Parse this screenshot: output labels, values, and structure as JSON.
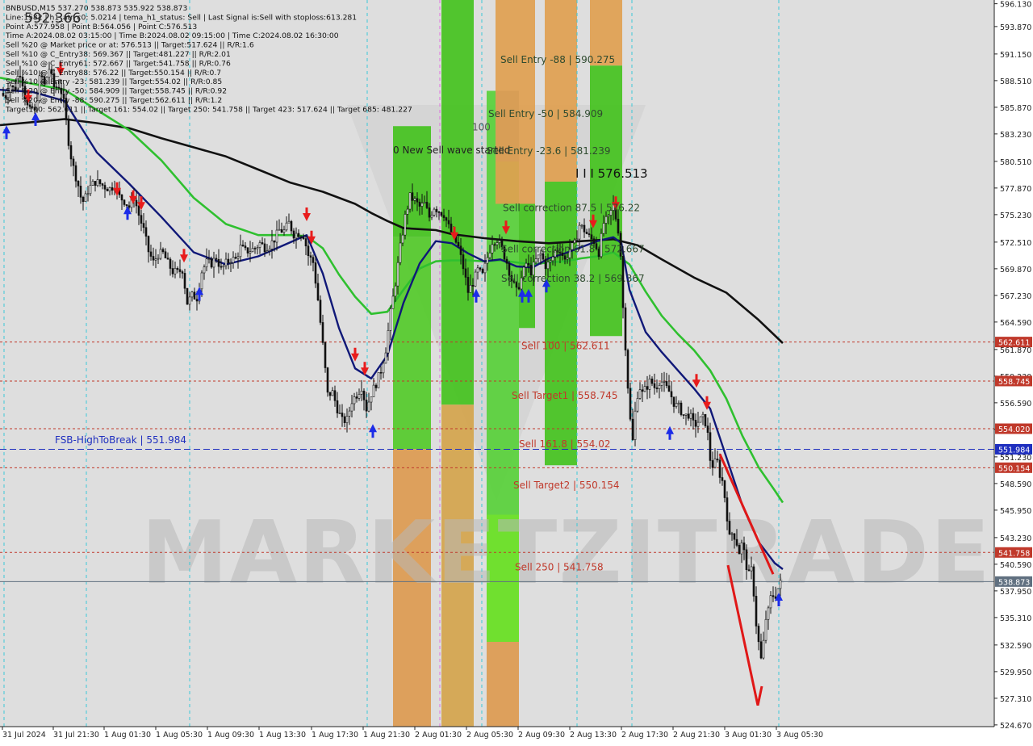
{
  "info_lines": [
    "BNBUSD,M15  537.270 538.873 535.922 538.873",
    "Line:1582 | h1_atr_c0: 5.0214 | tema_h1_status: Sell | Last Signal is:Sell with stoploss:613.281",
    "Point A:577.958 | Point B:564.056 | Point C:576.513",
    "Time A:2024.08.02 03:15:00 | Time B:2024.08.02 09:15:00 | Time C:2024.08.02 16:30:00",
    "Sell %20 @ Market price or at: 576.513 || Target:517.624 || R/R:1.6",
    "Sell %10 @ C_Entry38: 569.367 || Target:481.227 || R/R:2.01",
    "Sell %10 @ C_Entry61: 572.667 || Target:541.758 || R/R:0.76",
    "Sell %10 @ C_Entry88: 576.22 || Target:550.154 || R/R:0.7",
    "Sell %10 @ Entry -23: 581.239 || Target:554.02 || R/R:0.85",
    "Sell %20 @ Entry -50: 584.909 || Target:558.745 || R/R:0.92",
    "Sell %20 @ Entry -88: 590.275 || Target:562.611 || R/R:1.2",
    "Target100: 562.611 || Target 161: 554.02 || Target 250: 541.758 || Target 423: 517.624 || Target 685: 481.227"
  ],
  "top_value_label": "592.366",
  "watermark": "MARKETZITRADE",
  "chart_data": {
    "type": "candlestick",
    "symbol": "BNBUSD",
    "timeframe": "M15",
    "ylim": [
      524.5,
      596.5
    ],
    "y_ticks": [
      "596.130",
      "593.870",
      "591.150",
      "588.510",
      "585.870",
      "583.230",
      "580.510",
      "577.870",
      "575.230",
      "572.510",
      "569.870",
      "567.230",
      "564.590",
      "561.870",
      "559.230",
      "556.590",
      "553.950",
      "551.230",
      "548.590",
      "545.950",
      "543.230",
      "540.590",
      "537.950",
      "535.310",
      "532.590",
      "529.950",
      "527.310",
      "524.670"
    ],
    "x_ticks": [
      "31 Jul 2024",
      "31 Jul 21:30",
      "1 Aug 01:30",
      "1 Aug 05:30",
      "1 Aug 09:30",
      "1 Aug 13:30",
      "1 Aug 17:30",
      "1 Aug 21:30",
      "2 Aug 01:30",
      "2 Aug 05:30",
      "2 Aug 09:30",
      "2 Aug 13:30",
      "2 Aug 17:30",
      "2 Aug 21:30",
      "3 Aug 01:30",
      "3 Aug 05:30"
    ],
    "close_path": [
      [
        0,
        587.5
      ],
      [
        6,
        586.8
      ],
      [
        12,
        588.2
      ],
      [
        18,
        587.5
      ],
      [
        24,
        589.6
      ],
      [
        28,
        588.3
      ],
      [
        32,
        586.5
      ],
      [
        36,
        585.4
      ],
      [
        40,
        585.8
      ],
      [
        44,
        585.2
      ],
      [
        48,
        588.6
      ],
      [
        52,
        588.8
      ],
      [
        56,
        587.8
      ],
      [
        60,
        590.0
      ],
      [
        64,
        588.8
      ],
      [
        68,
        587.6
      ],
      [
        72,
        588.2
      ],
      [
        76,
        587.4
      ],
      [
        80,
        586.0
      ],
      [
        84,
        583.0
      ],
      [
        88,
        581.0
      ],
      [
        92,
        579.5
      ],
      [
        96,
        578.5
      ],
      [
        100,
        577.0
      ],
      [
        104,
        576.4
      ],
      [
        108,
        577.5
      ],
      [
        112,
        578.0
      ],
      [
        118,
        578.5
      ],
      [
        124,
        578.3
      ],
      [
        130,
        578.0
      ],
      [
        136,
        577.8
      ],
      [
        142,
        578.2
      ],
      [
        148,
        577.0
      ],
      [
        154,
        576.6
      ],
      [
        160,
        576.0
      ],
      [
        166,
        577.0
      ],
      [
        172,
        575.2
      ],
      [
        178,
        573.7
      ],
      [
        184,
        571.6
      ],
      [
        190,
        570.5
      ],
      [
        196,
        571.3
      ],
      [
        202,
        571.4
      ],
      [
        208,
        570.4
      ],
      [
        214,
        569.6
      ],
      [
        220,
        569.5
      ],
      [
        226,
        569.8
      ],
      [
        232,
        566.5
      ],
      [
        238,
        567.2
      ],
      [
        244,
        567.0
      ],
      [
        250,
        569.6
      ],
      [
        256,
        570.5
      ],
      [
        262,
        570.4
      ],
      [
        268,
        571.0
      ],
      [
        274,
        569.8
      ],
      [
        280,
        570.4
      ],
      [
        286,
        570.8
      ],
      [
        292,
        570.8
      ],
      [
        298,
        572.0
      ],
      [
        304,
        571.6
      ],
      [
        310,
        571.7
      ],
      [
        316,
        571.9
      ],
      [
        322,
        572.4
      ],
      [
        328,
        572.0
      ],
      [
        334,
        572.2
      ],
      [
        340,
        572.8
      ],
      [
        346,
        573.7
      ],
      [
        352,
        573.6
      ],
      [
        358,
        574.4
      ],
      [
        364,
        573.3
      ],
      [
        370,
        573.4
      ],
      [
        376,
        573.2
      ],
      [
        382,
        571.2
      ],
      [
        388,
        570.5
      ],
      [
        394,
        566.8
      ],
      [
        400,
        562.3
      ],
      [
        406,
        557.4
      ],
      [
        412,
        557.6
      ],
      [
        418,
        556.0
      ],
      [
        424,
        554.8
      ],
      [
        430,
        554.9
      ],
      [
        436,
        556.8
      ],
      [
        442,
        557.4
      ],
      [
        448,
        558.2
      ],
      [
        454,
        556.0
      ],
      [
        460,
        557.5
      ],
      [
        466,
        558.5
      ],
      [
        472,
        559.8
      ],
      [
        478,
        561.9
      ],
      [
        484,
        565.5
      ],
      [
        490,
        568.5
      ],
      [
        496,
        572.0
      ],
      [
        502,
        575.0
      ],
      [
        508,
        577.0
      ],
      [
        514,
        576.6
      ],
      [
        520,
        576.0
      ],
      [
        526,
        576.3
      ],
      [
        532,
        575.0
      ],
      [
        538,
        576.0
      ],
      [
        544,
        575.6
      ],
      [
        550,
        575.3
      ],
      [
        556,
        574.0
      ],
      [
        562,
        573.0
      ],
      [
        568,
        572.0
      ],
      [
        574,
        570.0
      ],
      [
        580,
        567.6
      ],
      [
        586,
        568.5
      ],
      [
        592,
        569.7
      ],
      [
        598,
        569.2
      ],
      [
        604,
        571.0
      ],
      [
        610,
        572.6
      ],
      [
        616,
        572.8
      ],
      [
        622,
        571.8
      ],
      [
        628,
        570.5
      ],
      [
        634,
        568.8
      ],
      [
        640,
        567.6
      ],
      [
        646,
        568.9
      ],
      [
        652,
        570.4
      ],
      [
        658,
        569.6
      ],
      [
        664,
        570.7
      ],
      [
        670,
        571.3
      ],
      [
        676,
        570.2
      ],
      [
        682,
        570.5
      ],
      [
        688,
        571.6
      ],
      [
        694,
        571.8
      ],
      [
        700,
        570.7
      ],
      [
        706,
        571.8
      ],
      [
        712,
        572.3
      ],
      [
        718,
        574.2
      ],
      [
        724,
        573.7
      ],
      [
        730,
        573.0
      ],
      [
        736,
        572.6
      ],
      [
        742,
        571.5
      ],
      [
        748,
        574.4
      ],
      [
        754,
        574.8
      ],
      [
        760,
        576.2
      ],
      [
        764,
        574.5
      ],
      [
        768,
        573.0
      ],
      [
        772,
        566.0
      ],
      [
        776,
        561.0
      ],
      [
        780,
        555.5
      ],
      [
        784,
        552.8
      ],
      [
        788,
        556.6
      ],
      [
        792,
        558.3
      ],
      [
        796,
        557.5
      ],
      [
        800,
        558.0
      ],
      [
        806,
        558.8
      ],
      [
        812,
        558.0
      ],
      [
        818,
        558.9
      ],
      [
        824,
        558.2
      ],
      [
        830,
        557.6
      ],
      [
        836,
        556.4
      ],
      [
        842,
        556.1
      ],
      [
        848,
        555.2
      ],
      [
        854,
        555.5
      ],
      [
        860,
        554.3
      ],
      [
        866,
        554.8
      ],
      [
        872,
        555.1
      ],
      [
        876,
        554.2
      ],
      [
        880,
        551.0
      ],
      [
        884,
        550.2
      ],
      [
        888,
        551.1
      ],
      [
        892,
        549.5
      ],
      [
        896,
        548.6
      ],
      [
        900,
        546.0
      ],
      [
        904,
        543.2
      ],
      [
        908,
        543.8
      ],
      [
        912,
        543.0
      ],
      [
        916,
        541.8
      ],
      [
        920,
        542.8
      ],
      [
        924,
        540.7
      ],
      [
        928,
        539.5
      ],
      [
        932,
        540.2
      ],
      [
        936,
        535.3
      ],
      [
        940,
        532.8
      ],
      [
        944,
        530.6
      ],
      [
        948,
        535.0
      ],
      [
        952,
        535.9
      ],
      [
        956,
        537.7
      ],
      [
        960,
        537.3
      ],
      [
        964,
        538.2
      ],
      [
        968,
        538.873
      ]
    ],
    "ema_blue": [
      [
        0,
        587.6
      ],
      [
        40,
        587.4
      ],
      [
        80,
        586.5
      ],
      [
        120,
        581.4
      ],
      [
        160,
        578.3
      ],
      [
        200,
        575.0
      ],
      [
        240,
        571.5
      ],
      [
        280,
        570.3
      ],
      [
        320,
        571.1
      ],
      [
        360,
        572.5
      ],
      [
        380,
        573.2
      ],
      [
        400,
        569.4
      ],
      [
        420,
        564.0
      ],
      [
        440,
        560.0
      ],
      [
        460,
        559.0
      ],
      [
        480,
        561.3
      ],
      [
        500,
        566.5
      ],
      [
        520,
        570.4
      ],
      [
        540,
        572.6
      ],
      [
        560,
        572.4
      ],
      [
        580,
        571.4
      ],
      [
        600,
        570.6
      ],
      [
        620,
        570.8
      ],
      [
        640,
        570.1
      ],
      [
        660,
        570.0
      ],
      [
        680,
        570.9
      ],
      [
        700,
        571.4
      ],
      [
        720,
        572.0
      ],
      [
        740,
        572.6
      ],
      [
        760,
        573.0
      ],
      [
        770,
        572.4
      ],
      [
        780,
        567.8
      ],
      [
        800,
        563.6
      ],
      [
        820,
        561.6
      ],
      [
        840,
        559.8
      ],
      [
        860,
        558.0
      ],
      [
        880,
        556.0
      ],
      [
        900,
        551.2
      ],
      [
        920,
        546.4
      ],
      [
        940,
        542.8
      ],
      [
        960,
        540.7
      ],
      [
        970,
        540.1
      ]
    ],
    "ema_green": [
      [
        0,
        588.8
      ],
      [
        40,
        588.2
      ],
      [
        80,
        587.6
      ],
      [
        120,
        585.6
      ],
      [
        160,
        583.6
      ],
      [
        200,
        580.6
      ],
      [
        240,
        576.9
      ],
      [
        280,
        574.3
      ],
      [
        320,
        573.2
      ],
      [
        360,
        573.2
      ],
      [
        380,
        573.1
      ],
      [
        400,
        571.9
      ],
      [
        420,
        569.3
      ],
      [
        440,
        567.1
      ],
      [
        460,
        565.4
      ],
      [
        480,
        565.6
      ],
      [
        500,
        567.8
      ],
      [
        520,
        569.9
      ],
      [
        540,
        570.6
      ],
      [
        560,
        570.7
      ],
      [
        580,
        570.7
      ],
      [
        600,
        570.6
      ],
      [
        620,
        570.7
      ],
      [
        640,
        570.5
      ],
      [
        660,
        570.3
      ],
      [
        680,
        570.5
      ],
      [
        700,
        570.6
      ],
      [
        720,
        570.9
      ],
      [
        740,
        571.1
      ],
      [
        760,
        571.5
      ],
      [
        780,
        570.3
      ],
      [
        800,
        567.6
      ],
      [
        820,
        565.2
      ],
      [
        840,
        563.4
      ],
      [
        860,
        561.8
      ],
      [
        880,
        559.8
      ],
      [
        900,
        557.0
      ],
      [
        920,
        553.3
      ],
      [
        940,
        550.2
      ],
      [
        960,
        547.9
      ],
      [
        970,
        546.7
      ]
    ],
    "ema_black": [
      [
        0,
        584.1
      ],
      [
        40,
        584.4
      ],
      [
        80,
        584.7
      ],
      [
        120,
        584.3
      ],
      [
        160,
        583.8
      ],
      [
        200,
        582.8
      ],
      [
        240,
        581.9
      ],
      [
        280,
        581.0
      ],
      [
        320,
        579.7
      ],
      [
        360,
        578.4
      ],
      [
        400,
        577.5
      ],
      [
        440,
        576.3
      ],
      [
        460,
        575.4
      ],
      [
        480,
        574.6
      ],
      [
        500,
        573.9
      ],
      [
        520,
        573.8
      ],
      [
        540,
        573.7
      ],
      [
        560,
        573.3
      ],
      [
        600,
        572.9
      ],
      [
        640,
        572.6
      ],
      [
        680,
        572.4
      ],
      [
        720,
        572.6
      ],
      [
        760,
        572.8
      ],
      [
        790,
        572.2
      ],
      [
        820,
        570.8
      ],
      [
        860,
        569.0
      ],
      [
        900,
        567.5
      ],
      [
        940,
        564.8
      ],
      [
        970,
        562.5
      ]
    ],
    "h_lines": [
      {
        "name": "Sell 100 | 562.611",
        "value": 562.611,
        "color": "#c0392b",
        "axis_label": "562.611"
      },
      {
        "name": "Sell Target1 | 558.745",
        "value": 558.745,
        "color": "#c0392b",
        "axis_label": "558.745"
      },
      {
        "name": "Sell 161.8 | 554.02",
        "value": 554.02,
        "color": "#c0392b",
        "axis_label": "554.020"
      },
      {
        "name": "FSB-HighToBreak | 551.984",
        "value": 551.984,
        "color": "#1f2fbf",
        "axis_label": "551.984"
      },
      {
        "name": "Sell Target2 | 550.154",
        "value": 550.154,
        "color": "#c0392b",
        "axis_label": "550.154"
      },
      {
        "name": "Sell 250 | 541.758",
        "value": 541.758,
        "color": "#c0392b",
        "axis_label": "541.758"
      },
      {
        "name": "",
        "value": 538.873,
        "color": "#607080",
        "axis_label": "538.873"
      }
    ],
    "annotations": [
      {
        "text": "Sell Entry -88 | 590.275",
        "x": 620,
        "value": 590.275,
        "color": "#2e4a2e"
      },
      {
        "text": "Sell Entry -50 | 584.909",
        "x": 605,
        "value": 584.909,
        "color": "#2e4a2e"
      },
      {
        "text": "100",
        "x": 585,
        "value": 583.6,
        "color": "#555555"
      },
      {
        "text": "0 New Sell wave started",
        "x": 487,
        "value": 581.3,
        "color": "#222222"
      },
      {
        "text": "Sell Entry -23.6 | 581.239",
        "x": 603,
        "value": 581.239,
        "color": "#2e4a2e"
      },
      {
        "text": "I I I 576.513",
        "x": 713,
        "value": 578.9,
        "color": "#111111",
        "large": true
      },
      {
        "text": "Sell correction 87.5 | 576.22",
        "x": 623,
        "value": 575.6,
        "color": "#2e4a2e"
      },
      {
        "text": "Sell correction 61.8 | 572.667",
        "x": 621,
        "value": 571.5,
        "color": "#2e4a2e"
      },
      {
        "text": "Sell correction 38.2 | 569.367",
        "x": 621,
        "value": 568.6,
        "color": "#2e4a2e"
      },
      {
        "text": "Sell 100 | 562.611",
        "x": 646,
        "value": 561.9,
        "color": "#c0392b"
      },
      {
        "text": "Sell Target1 | 558.745",
        "x": 634,
        "value": 557.0,
        "color": "#c0392b"
      },
      {
        "text": "Sell 161.8 | 554.02",
        "x": 643,
        "value": 552.2,
        "color": "#c0392b"
      },
      {
        "text": "Sell Target2 | 550.154",
        "x": 636,
        "value": 548.1,
        "color": "#c0392b"
      },
      {
        "text": "Sell  250 | 541.758",
        "x": 638,
        "value": 540.0,
        "color": "#c0392b"
      },
      {
        "text": "FSB-HighToBreak | 551.984",
        "x": 68,
        "value": 552.6,
        "color": "#1f2fbf"
      }
    ],
    "bands": [
      {
        "x": 487,
        "w": 47,
        "from": 584.0,
        "to": 573.0,
        "color": "#44c21e"
      },
      {
        "x": 487,
        "w": 47,
        "from": 573.0,
        "to": 552.0,
        "color": "#54ca2a"
      },
      {
        "x": 487,
        "w": 47,
        "from": 552.0,
        "to": 524.5,
        "color": "#dc9a50"
      },
      {
        "x": 547,
        "w": 40,
        "from": 596.5,
        "to": 556.4,
        "color": "#44c21e"
      },
      {
        "x": 547,
        "w": 40,
        "from": 556.4,
        "to": 524.5,
        "color": "#d4a44c"
      },
      {
        "x": 603,
        "w": 40,
        "from": 587.5,
        "to": 545.5,
        "color": "#58d03a"
      },
      {
        "x": 603,
        "w": 40,
        "from": 545.5,
        "to": 532.9,
        "color": "#66e020"
      },
      {
        "x": 603,
        "w": 40,
        "from": 532.9,
        "to": 524.5,
        "color": "#dc9a50"
      },
      {
        "x": 614,
        "w": 29,
        "from": 587.5,
        "to": 580.5,
        "color": "#7c86a0"
      },
      {
        "x": 614,
        "w": 49,
        "from": 596.5,
        "to": 576.3,
        "color": "#e0a050"
      },
      {
        "x": 643,
        "w": 20,
        "from": 576.3,
        "to": 564.0,
        "color": "#44c21e"
      },
      {
        "x": 675,
        "w": 40,
        "from": 596.5,
        "to": 578.5,
        "color": "#e0a050"
      },
      {
        "x": 675,
        "w": 40,
        "from": 578.5,
        "to": 550.4,
        "color": "#44c21e"
      },
      {
        "x": 731,
        "w": 40,
        "from": 596.5,
        "to": 590.0,
        "color": "#e0a050"
      },
      {
        "x": 731,
        "w": 40,
        "from": 590.0,
        "to": 563.2,
        "color": "#44c21e"
      }
    ]
  }
}
